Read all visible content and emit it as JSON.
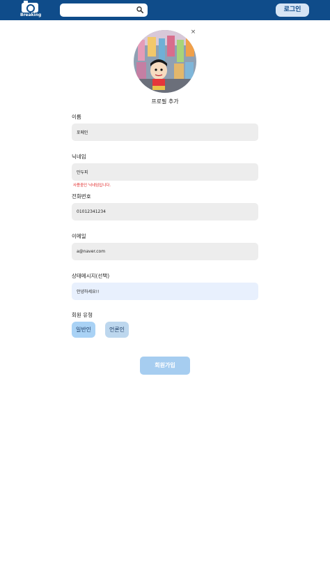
{
  "header": {
    "logo_text": "Breaking",
    "search": {
      "placeholder": "",
      "value": ""
    },
    "login_label": "로그인"
  },
  "profile": {
    "add_label": "프로필 추가",
    "close_glyph": "×"
  },
  "form": {
    "name": {
      "label": "이름",
      "value": "포메인"
    },
    "nickname": {
      "label": "닉네임",
      "value": "만두피",
      "error": "사용중인 닉네임입니다."
    },
    "phone": {
      "label": "전화번호",
      "value": "01012341234"
    },
    "email": {
      "label": "이메일",
      "value": "a@naver.com"
    },
    "status": {
      "label": "상태메시지(선택)",
      "value": "안녕하세요!!"
    },
    "member_type": {
      "label": "회원 유형",
      "options": [
        "일반인",
        "언론인"
      ]
    },
    "submit_label": "회원가입"
  },
  "colors": {
    "header_bg": "#0f4c8a",
    "field_bg": "#ededed",
    "status_field_bg": "#e8f0fd",
    "error": "#e02020",
    "submit_bg": "#a6cdf0"
  }
}
